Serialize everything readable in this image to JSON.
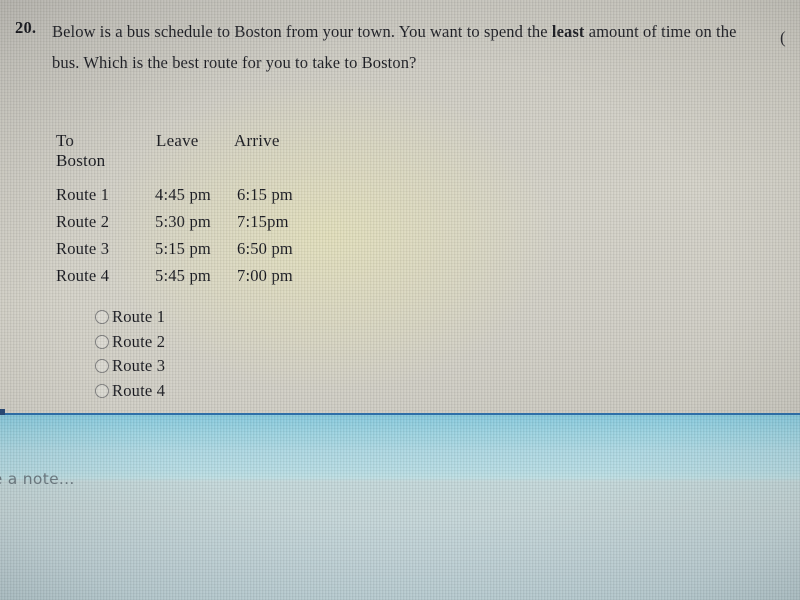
{
  "question": {
    "number": "20.",
    "text_before_bold": "Below is a bus schedule to Boston from your town. You want to spend the ",
    "bold_word": "least",
    "text_after_bold": " amount of time on the bus. Which is the best route for you to take to Boston?",
    "trailing_paren": "("
  },
  "schedule": {
    "headers": {
      "route": "To Boston",
      "leave": "Leave",
      "arrive": "Arrive"
    },
    "rows": [
      {
        "route": "Route 1",
        "leave": "4:45 pm",
        "arrive": "6:15 pm"
      },
      {
        "route": "Route 2",
        "leave": "5:30 pm",
        "arrive": "7:15pm"
      },
      {
        "route": "Route 3",
        "leave": "5:15 pm",
        "arrive": "6:50 pm"
      },
      {
        "route": "Route 4",
        "leave": "5:45 pm",
        "arrive": "7:00 pm"
      }
    ]
  },
  "options": [
    {
      "label": "Route 1",
      "selected": false
    },
    {
      "label": "Route 2",
      "selected": false
    },
    {
      "label": "Route 3",
      "selected": false
    },
    {
      "label": "Route 4",
      "selected": false
    }
  ],
  "note_pane": {
    "placeholder_visible": "ke a note..."
  },
  "colors": {
    "divider": "#2f6fa8",
    "note_band": "#9ed2e0",
    "paper": "#cdcbc2",
    "text": "#15161c"
  }
}
